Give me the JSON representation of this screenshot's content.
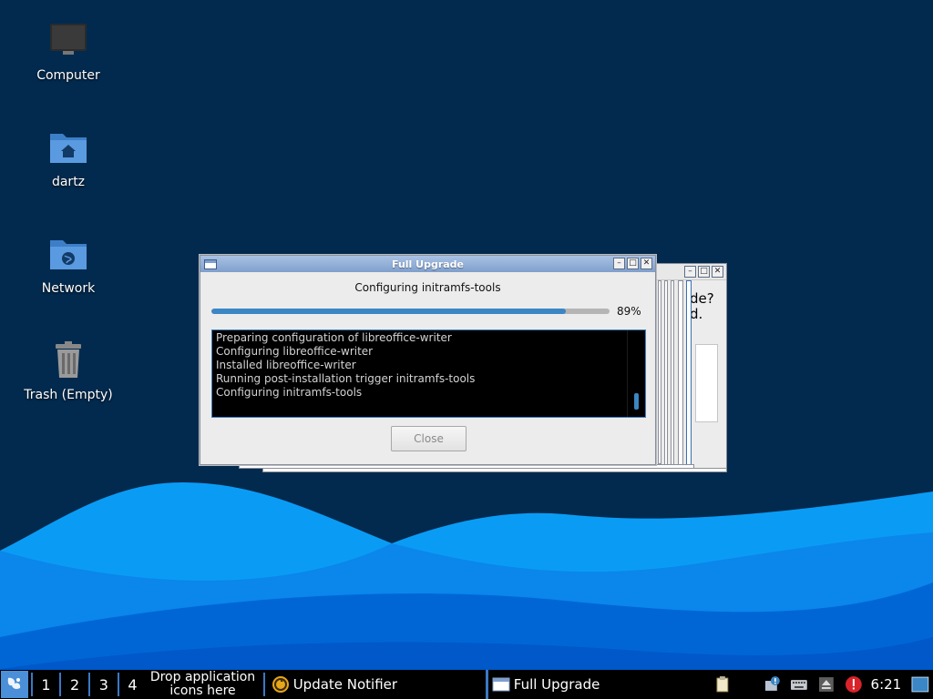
{
  "desktop": {
    "icons": [
      {
        "label": "Computer",
        "icon": "computer-icon"
      },
      {
        "label": "dartz",
        "icon": "home-folder-icon"
      },
      {
        "label": "Network",
        "icon": "network-folder-icon"
      },
      {
        "label": "Trash (Empty)",
        "icon": "trash-icon"
      }
    ]
  },
  "background_window": {
    "text_line1": "de?",
    "text_line2": "d."
  },
  "upgrade_dialog": {
    "title": "Full Upgrade",
    "status": "Configuring initramfs-tools",
    "progress": 0.89,
    "progress_label": "89%",
    "log": [
      "Preparing configuration of libreoffice-writer",
      "Configuring libreoffice-writer",
      "Installed libreoffice-writer",
      "Running post-installation trigger initramfs-tools",
      "Configuring initramfs-tools"
    ],
    "close_label": "Close"
  },
  "taskbar": {
    "workspaces": [
      "1",
      "2",
      "3",
      "4"
    ],
    "launcher_hint": "Drop application icons here",
    "tasks": [
      {
        "label": "Update Notifier",
        "icon": "update-notifier-icon"
      },
      {
        "label": "Full Upgrade",
        "icon": "window-icon"
      }
    ],
    "clock": "6:21"
  },
  "colors": {
    "desktop_bg": "#022a4e",
    "wave_light": "#0a9cf5",
    "wave_dark": "#0066d6",
    "accent": "#3b86c4",
    "alert": "#d8232a"
  }
}
